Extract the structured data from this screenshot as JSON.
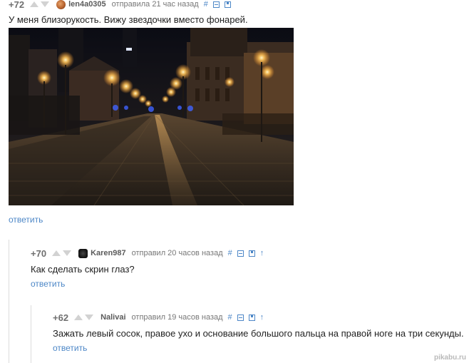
{
  "comments": [
    {
      "rating": "+72",
      "author": "len4a0305",
      "time": "отправила 21 час назад",
      "text": "У меня близорукость. Вижу звездочки вместо фонарей.",
      "reply": "ответить",
      "tools": {
        "hash": "#",
        "collapse": "⊟",
        "save": "save-icon"
      }
    },
    {
      "rating": "+70",
      "author": "Karen987",
      "time": "отправил 20 часов назад",
      "text": "Как сделать скрин глаз?",
      "reply": "ответить",
      "tools": {
        "hash": "#",
        "collapse": "⊟",
        "save": "save-icon",
        "parent": "↑"
      }
    },
    {
      "rating": "+62",
      "author": "Nalivai",
      "time": "отправил 19 часов назад",
      "text": "Зажать левый сосок, правое ухо и основание большого пальца на правой ноге на три секунды.",
      "reply": "ответить",
      "tools": {
        "hash": "#",
        "collapse": "⊟",
        "save": "save-icon",
        "parent": "↑"
      }
    }
  ],
  "watermark": "pikabu.ru",
  "colors": {
    "link": "#4d87c7",
    "rating": "#6f6f6f",
    "vote_arrow": "#d2d2d2",
    "thread_line": "#dcdcdc"
  }
}
